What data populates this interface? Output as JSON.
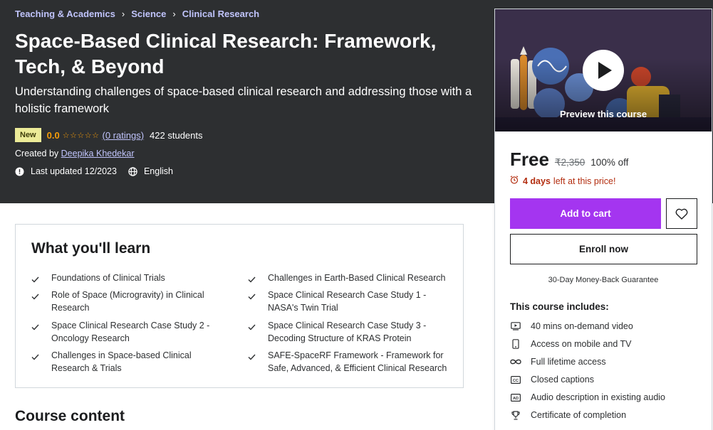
{
  "breadcrumb": [
    "Teaching & Academics",
    "Science",
    "Clinical Research"
  ],
  "course": {
    "title": "Space-Based Clinical Research: Framework, Tech, & Beyond",
    "subtitle": "Understanding challenges of space-based clinical research and addressing those with a holistic framework",
    "badge": "New",
    "rating": "0.0",
    "stars": "☆☆☆☆☆",
    "ratings_link": "(0 ratings)",
    "students": "422 students",
    "created_by_label": "Created by",
    "instructor": "Deepika Khedekar",
    "last_updated": "Last updated 12/2023",
    "language": "English"
  },
  "learn": {
    "title": "What you'll learn",
    "items": [
      "Foundations of Clinical Trials",
      "Challenges in Earth-Based Clinical Research",
      "Role of Space (Microgravity) in Clinical Research",
      "Space Clinical Research Case Study 1 - NASA's Twin Trial",
      "Space Clinical Research Case Study 2 - Oncology Research",
      "Space Clinical Research Case Study 3 - Decoding Structure of KRAS Protein",
      "Challenges in Space-based Clinical Research & Trials",
      "SAFE-SpaceRF Framework - Framework for Safe, Advanced, & Efficient Clinical Research"
    ]
  },
  "course_content_title": "Course content",
  "sidebar": {
    "preview_label": "Preview this course",
    "price": "Free",
    "original_price": "₹2,350",
    "discount": "100% off",
    "timer_bold": "4 days",
    "timer_rest": "left at this price!",
    "add_to_cart": "Add to cart",
    "enroll": "Enroll now",
    "guarantee": "30-Day Money-Back Guarantee",
    "includes_title": "This course includes:",
    "includes": [
      {
        "icon": "video-icon",
        "text": "40 mins on-demand video"
      },
      {
        "icon": "mobile-icon",
        "text": "Access on mobile and TV"
      },
      {
        "icon": "infinity-icon",
        "text": "Full lifetime access"
      },
      {
        "icon": "captions-icon",
        "text": "Closed captions"
      },
      {
        "icon": "audio-description-icon",
        "text": "Audio description in existing audio"
      },
      {
        "icon": "trophy-icon",
        "text": "Certificate of completion"
      }
    ]
  },
  "colors": {
    "hero_bg": "#2d2f31",
    "link": "#c0c4fc",
    "accent_purple": "#a435f0",
    "star": "#f69c08",
    "timer_red": "#b32d0f"
  }
}
